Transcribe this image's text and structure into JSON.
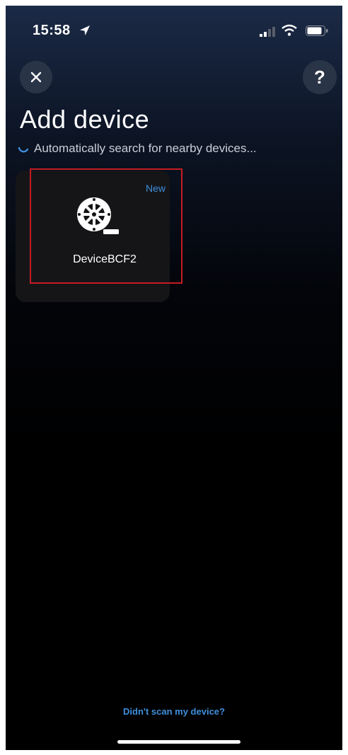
{
  "status_bar": {
    "time": "15:58",
    "icons": [
      "location-arrow-icon",
      "signal-icon",
      "wifi-icon",
      "battery-icon"
    ]
  },
  "header": {
    "close_icon": "close-icon",
    "help_label": "?",
    "title": "Add device",
    "search_status": "Automatically search for nearby devices..."
  },
  "devices": [
    {
      "name": "DeviceBCF2",
      "badge": "New",
      "icon": "device-reel-icon"
    }
  ],
  "footer": {
    "link_text": "Didn't scan my device?"
  },
  "colors": {
    "accent": "#3f8fdc",
    "highlight_border": "#c61b22",
    "button_bg": "#2a3447",
    "card_bg": "#151518"
  }
}
